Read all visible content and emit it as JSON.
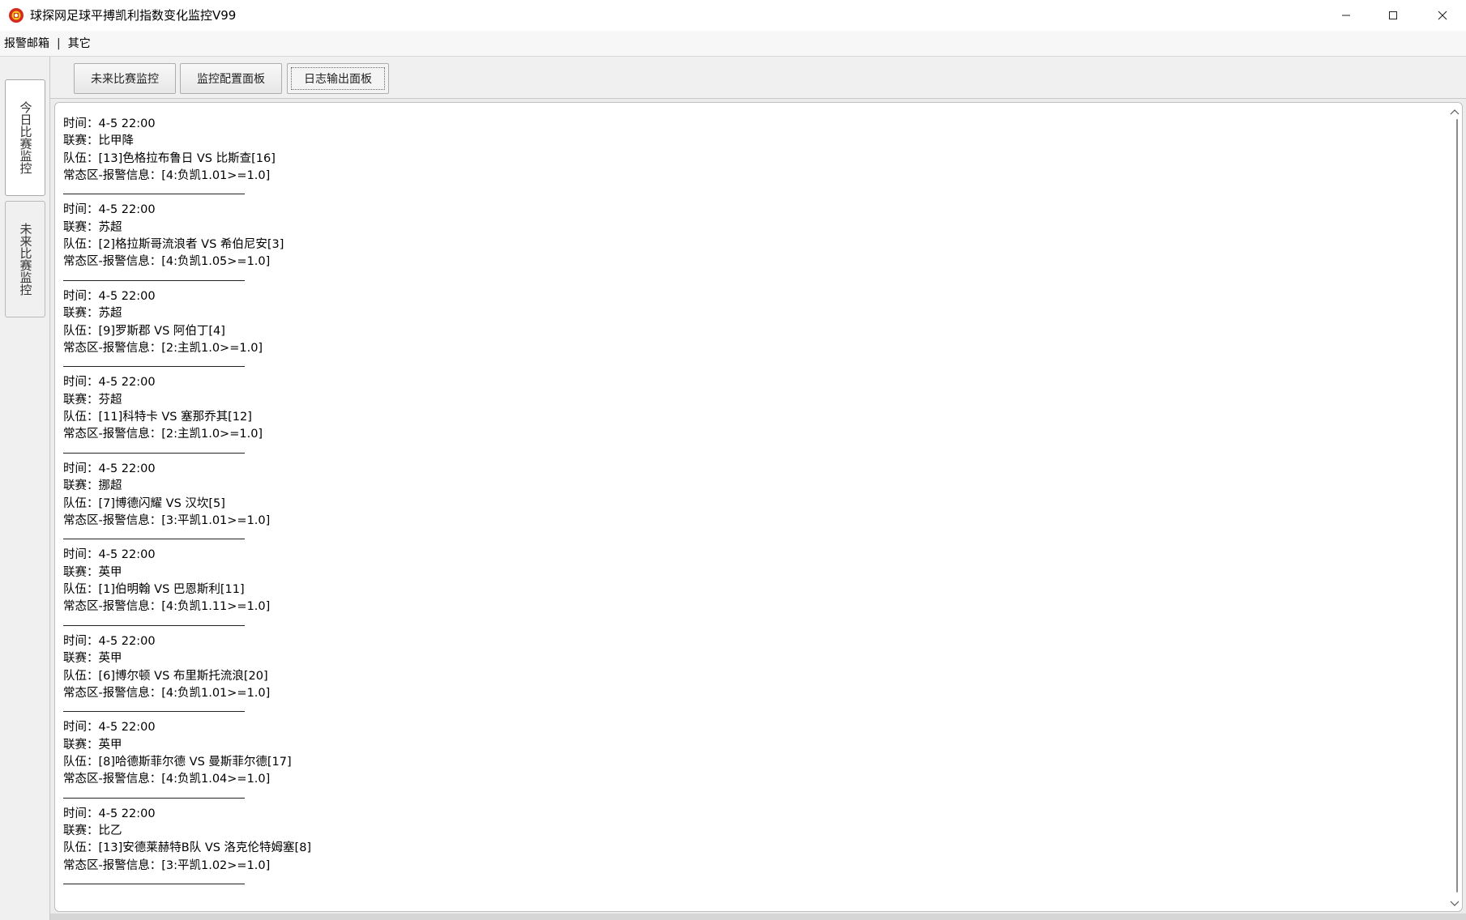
{
  "window": {
    "title": "球探网足球平搏凯利指数变化监控V99"
  },
  "menu": {
    "items": [
      "报警邮箱",
      "其它"
    ],
    "separator": "|"
  },
  "side_tabs": [
    {
      "label": "今日比赛监控",
      "active": true
    },
    {
      "label": "未来比赛监控",
      "active": false
    }
  ],
  "top_tabs": [
    {
      "label": "未来比赛监控",
      "active": false
    },
    {
      "label": "监控配置面板",
      "active": false
    },
    {
      "label": "日志输出面板",
      "active": true
    }
  ],
  "log": [
    {
      "time": "时间：4-5 22:00",
      "league": "联赛：比甲降",
      "teams": "队伍：[13]色格拉布鲁日 VS 比斯查[16]",
      "alert": "常态区-报警信息：[4:负凯1.01>=1.0]"
    },
    {
      "time": "时间：4-5 22:00",
      "league": "联赛：苏超",
      "teams": "队伍：[2]格拉斯哥流浪者 VS 希伯尼安[3]",
      "alert": "常态区-报警信息：[4:负凯1.05>=1.0]"
    },
    {
      "time": "时间：4-5 22:00",
      "league": "联赛：苏超",
      "teams": "队伍：[9]罗斯郡 VS 阿伯丁[4]",
      "alert": "常态区-报警信息：[2:主凯1.0>=1.0]"
    },
    {
      "time": "时间：4-5 22:00",
      "league": "联赛：芬超",
      "teams": "队伍：[11]科特卡 VS 塞那乔其[12]",
      "alert": "常态区-报警信息：[2:主凯1.0>=1.0]"
    },
    {
      "time": "时间：4-5 22:00",
      "league": "联赛：挪超",
      "teams": "队伍：[7]博德闪耀 VS 汉坎[5]",
      "alert": "常态区-报警信息：[3:平凯1.01>=1.0]"
    },
    {
      "time": "时间：4-5 22:00",
      "league": "联赛：英甲",
      "teams": "队伍：[1]伯明翰 VS 巴恩斯利[11]",
      "alert": "常态区-报警信息：[4:负凯1.11>=1.0]"
    },
    {
      "time": "时间：4-5 22:00",
      "league": "联赛：英甲",
      "teams": "队伍：[6]博尔顿 VS 布里斯托流浪[20]",
      "alert": "常态区-报警信息：[4:负凯1.01>=1.0]"
    },
    {
      "time": "时间：4-5 22:00",
      "league": "联赛：英甲",
      "teams": "队伍：[8]哈德斯菲尔德 VS 曼斯菲尔德[17]",
      "alert": "常态区-报警信息：[4:负凯1.04>=1.0]"
    },
    {
      "time": "时间：4-5 22:00",
      "league": "联赛：比乙",
      "teams": "队伍：[13]安德莱赫特B队 VS 洛克伦特姆塞[8]",
      "alert": "常态区-报警信息：[3:平凯1.02>=1.0]"
    }
  ],
  "icons": {
    "app": "app-logo-icon",
    "minimize": "minimize-icon",
    "maximize": "maximize-icon",
    "close": "close-icon",
    "scroll_up": "chevron-up-icon",
    "scroll_down": "chevron-down-icon"
  },
  "colors": {
    "app_icon_red": "#d62a1e",
    "app_icon_yellow": "#f2c21b"
  }
}
